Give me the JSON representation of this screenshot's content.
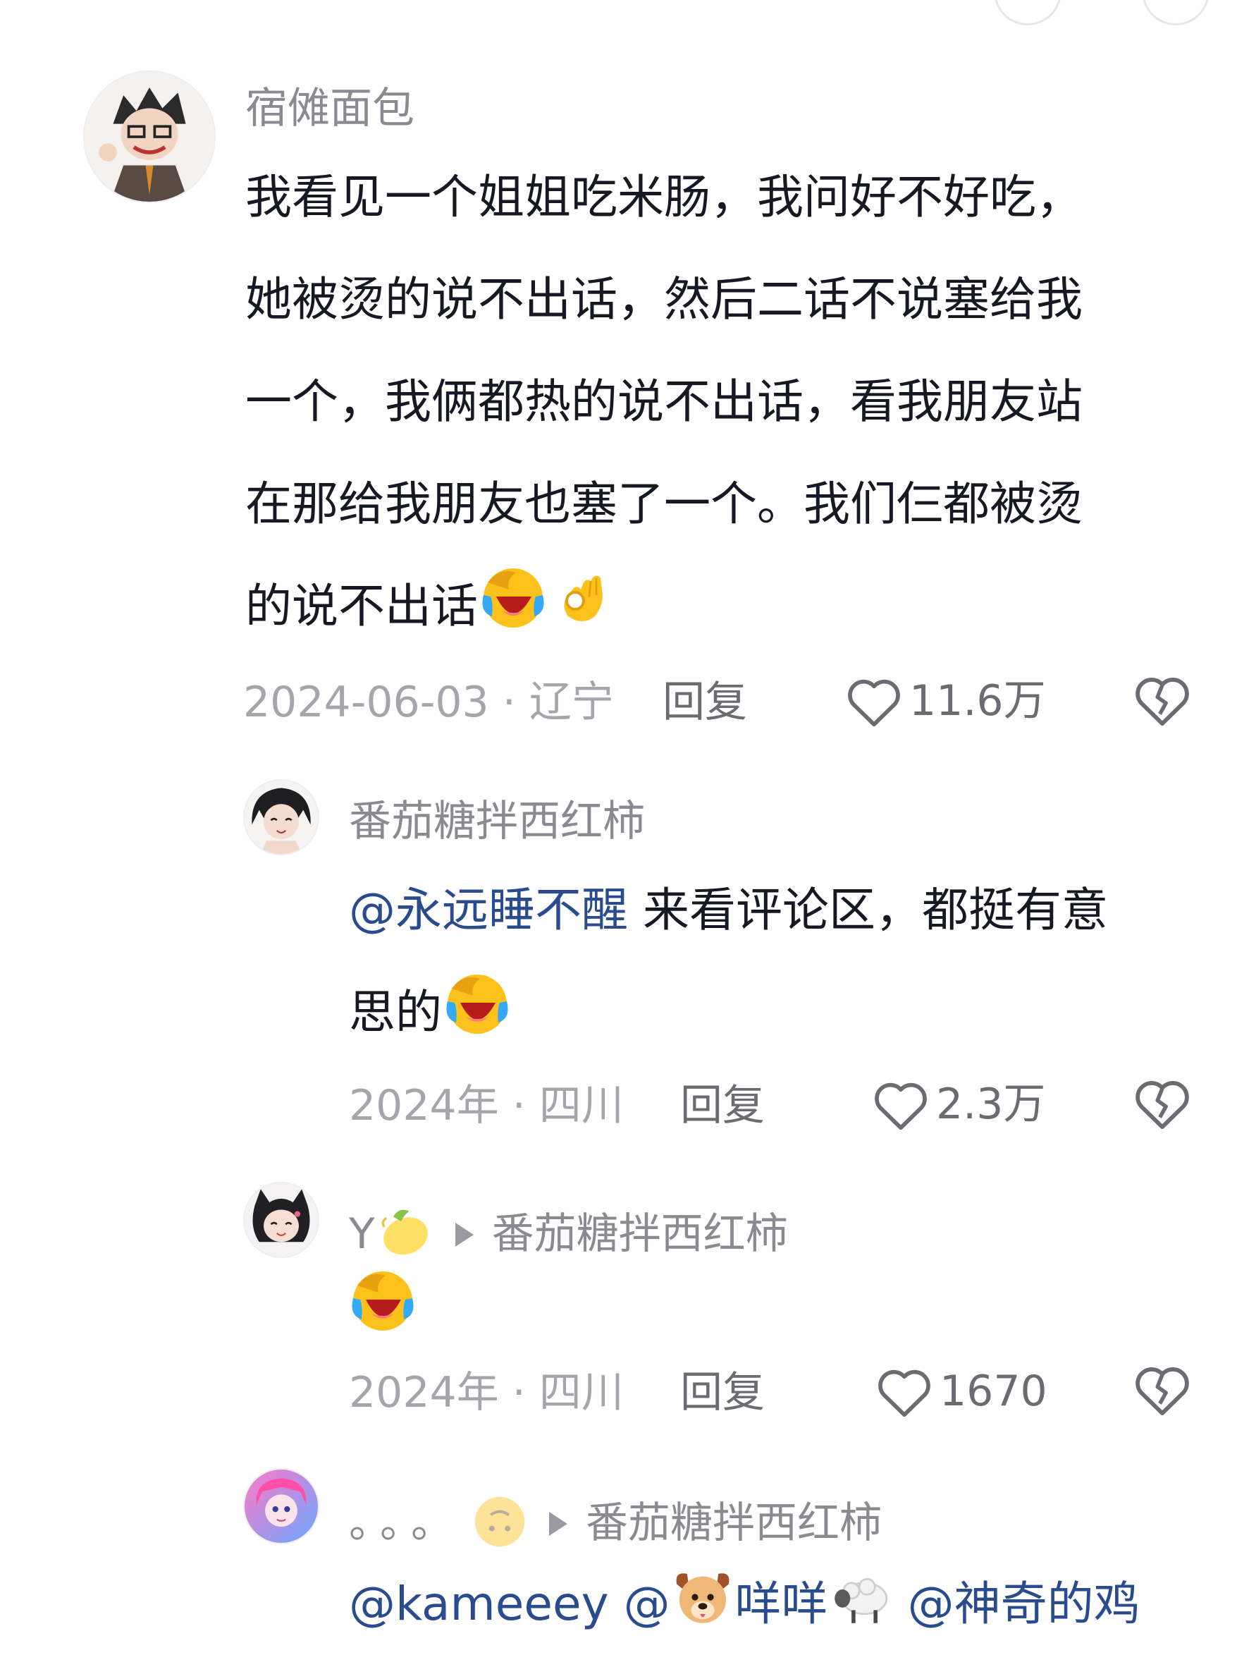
{
  "comments": [
    {
      "username": "宿傩面包",
      "text_lines": [
        "我看见一个姐姐吃米肠，我问好不好吃，",
        "她被烫的说不出话，然后二话不说塞给我",
        "一个，我俩都热的说不出话，看我朋友站",
        "在那给我朋友也塞了一个。我们仨都被烫",
        "的说不出话"
      ],
      "emojis": [
        "laughing-crying-emoji",
        "ok-hand-emoji"
      ],
      "date_location": "2024-06-03 · 辽宁",
      "reply_label": "回复",
      "likes": "11.6万"
    },
    {
      "username": "番茄糖拌西红柿",
      "mention": "@永远睡不醒",
      "text_line1": " 来看评论区，都挺有意",
      "text_line2": "思的",
      "date_location": "2024年 · 四川",
      "reply_label": "回复",
      "likes": "2.3万"
    },
    {
      "username": "Y",
      "reply_to": "番茄糖拌西红柿",
      "date_location": "2024年 · 四川",
      "reply_label": "回复",
      "likes": "1670"
    },
    {
      "username": "。。。",
      "reply_to": "番茄糖拌西红柿",
      "mention1": "@kameeey",
      "mention2": "@",
      "name2": "咩咩",
      "mention3": "@神奇的鸡"
    }
  ],
  "colors": {
    "mention": "#2a4b8d",
    "meta": "#a5a6ab",
    "username": "#8a8b91"
  }
}
